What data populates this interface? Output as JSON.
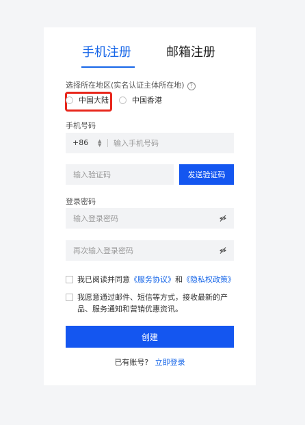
{
  "tabs": {
    "phone": "手机注册",
    "email": "邮箱注册"
  },
  "region": {
    "label": "选择所在地区(实名认证主体所在地)",
    "help_icon": "?",
    "options": [
      "中国大陆",
      "中国香港"
    ]
  },
  "phone": {
    "label": "手机号码",
    "country_code": "+86",
    "placeholder": "输入手机号码"
  },
  "verify": {
    "placeholder": "输入验证码",
    "send_label": "发送验证码"
  },
  "password": {
    "label": "登录密码",
    "placeholder": "输入登录密码",
    "confirm_placeholder": "再次输入登录密码"
  },
  "agreement": {
    "prefix": "我已阅读并同意",
    "service_link": "《服务协议》",
    "and": "和",
    "privacy_link": "《隐私权政策》"
  },
  "marketing": {
    "text": "我愿意通过邮件、短信等方式，接收最新的产品、服务通知和营销优惠资讯。"
  },
  "create_label": "创建",
  "login_prompt": {
    "text": "已有账号?",
    "link": "立即登录"
  },
  "colors": {
    "accent": "#1456f0",
    "highlight": "#e8261b"
  }
}
